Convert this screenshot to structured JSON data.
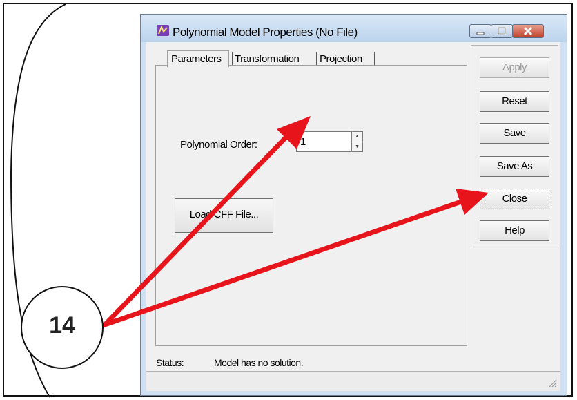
{
  "window": {
    "title": "Polynomial Model Properties (No File)"
  },
  "tabs": [
    {
      "label": "Parameters",
      "active": true
    },
    {
      "label": "Transformation",
      "active": false
    },
    {
      "label": "Projection",
      "active": false
    }
  ],
  "parameters": {
    "order_label": "Polynomial Order:",
    "order_value": "1",
    "load_button": "Load CFF File..."
  },
  "side_buttons": {
    "apply": "Apply",
    "reset": "Reset",
    "save": "Save",
    "save_as": "Save As",
    "close": "Close",
    "help": "Help"
  },
  "status": {
    "label": "Status:",
    "text": "Model has no solution."
  },
  "callout": {
    "number": "14"
  },
  "colors": {
    "arrow": "#e8141b",
    "title_bar": "#cfe0f2",
    "close_button": "#c0412c"
  }
}
